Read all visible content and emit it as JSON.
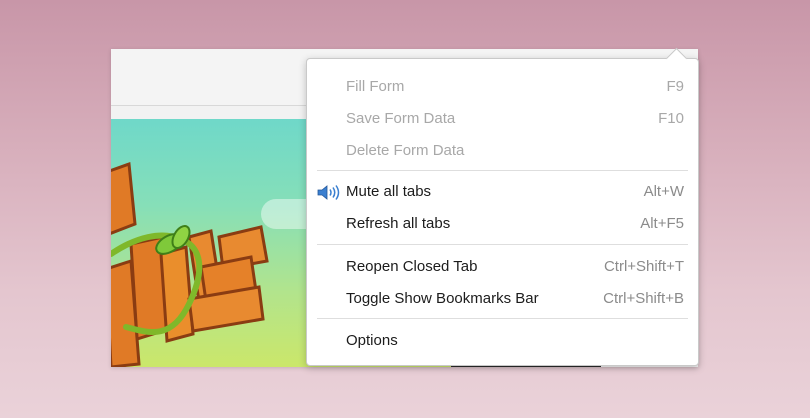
{
  "menu": {
    "groups": [
      [
        {
          "label": "Fill Form",
          "shortcut": "F9",
          "enabled": false
        },
        {
          "label": "Save Form Data",
          "shortcut": "F10",
          "enabled": false
        },
        {
          "label": "Delete Form Data",
          "shortcut": "",
          "enabled": false
        }
      ],
      [
        {
          "label": "Mute all tabs",
          "shortcut": "Alt+W",
          "enabled": true,
          "icon": "speaker-icon"
        },
        {
          "label": "Refresh all tabs",
          "shortcut": "Alt+F5",
          "enabled": true
        }
      ],
      [
        {
          "label": "Reopen Closed Tab",
          "shortcut": "Ctrl+Shift+T",
          "enabled": true
        },
        {
          "label": "Toggle Show Bookmarks Bar",
          "shortcut": "Ctrl+Shift+B",
          "enabled": true
        }
      ],
      [
        {
          "label": "Options",
          "shortcut": "",
          "enabled": true
        }
      ]
    ]
  },
  "colors": {
    "disabled_text": "#a8a8a8",
    "enabled_text": "#1c1c1c",
    "shortcut_text": "#8b8b8b",
    "icon_blue": "#3a7fd0"
  }
}
